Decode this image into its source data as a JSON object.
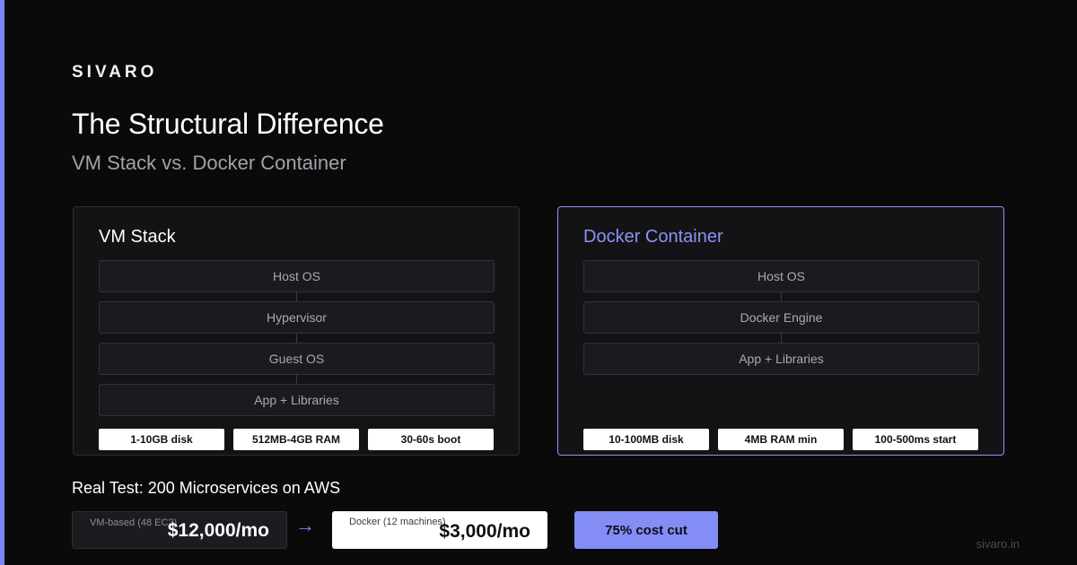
{
  "brand": "SIVARO",
  "title": "The Structural Difference",
  "subtitle": "VM Stack vs. Docker Container",
  "colors": {
    "background": "#0a0a0b",
    "accent": "#7b86f2",
    "panel": "#131316",
    "badge": "#848df6"
  },
  "vm_panel": {
    "title": "VM Stack",
    "layers": [
      "Host OS",
      "Hypervisor",
      "Guest OS",
      "App + Libraries"
    ],
    "stats": [
      "1-10GB disk",
      "512MB-4GB RAM",
      "30-60s boot"
    ]
  },
  "docker_panel": {
    "title": "Docker Container",
    "layers": [
      "Host OS",
      "Docker Engine",
      "App + Libraries"
    ],
    "stats": [
      "10-100MB disk",
      "4MB RAM min",
      "100-500ms start"
    ]
  },
  "test": {
    "title": "Real Test: 200 Microservices on AWS",
    "vm_label": "VM-based (48 EC2)",
    "vm_cost": "$12,000/mo",
    "arrow": "→",
    "docker_label": "Docker (12 machines)",
    "docker_cost": "$3,000/mo",
    "savings": "75% cost cut"
  },
  "footer": {
    "url": "sivaro.in"
  }
}
